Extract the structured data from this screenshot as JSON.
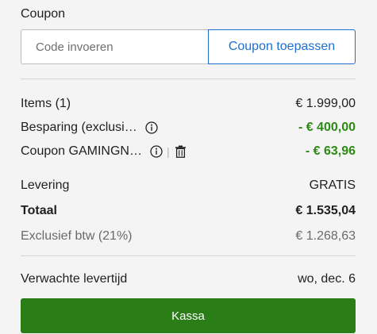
{
  "coupon": {
    "label": "Coupon",
    "input_placeholder": "Code invoeren",
    "input_value": "",
    "apply_label": "Coupon toepassen"
  },
  "summary": {
    "items_label": "Items (1)",
    "items_value": "€ 1.999,00",
    "savings_label": "Besparing (exclusi…",
    "savings_value": "- € 400,00",
    "coupon_line_label": "Coupon GAMINGN…",
    "coupon_separator": "|",
    "coupon_line_value": "- € 63,96",
    "delivery_label": "Levering",
    "delivery_value": "GRATIS",
    "total_label": "Totaal",
    "total_value": "€ 1.535,04",
    "excl_vat_label": "Exclusief btw (21%)",
    "excl_vat_value": "€ 1.268,63"
  },
  "delivery": {
    "expected_label": "Verwachte levertijd",
    "expected_value": "wo, dec. 6"
  },
  "checkout": {
    "label": "Kassa"
  },
  "colors": {
    "accent_blue": "#1f6fcf",
    "discount_green": "#2c8a15",
    "checkout_green": "#2a7d17"
  },
  "icons": {
    "info": "info-circle-icon",
    "trash": "trash-icon"
  }
}
